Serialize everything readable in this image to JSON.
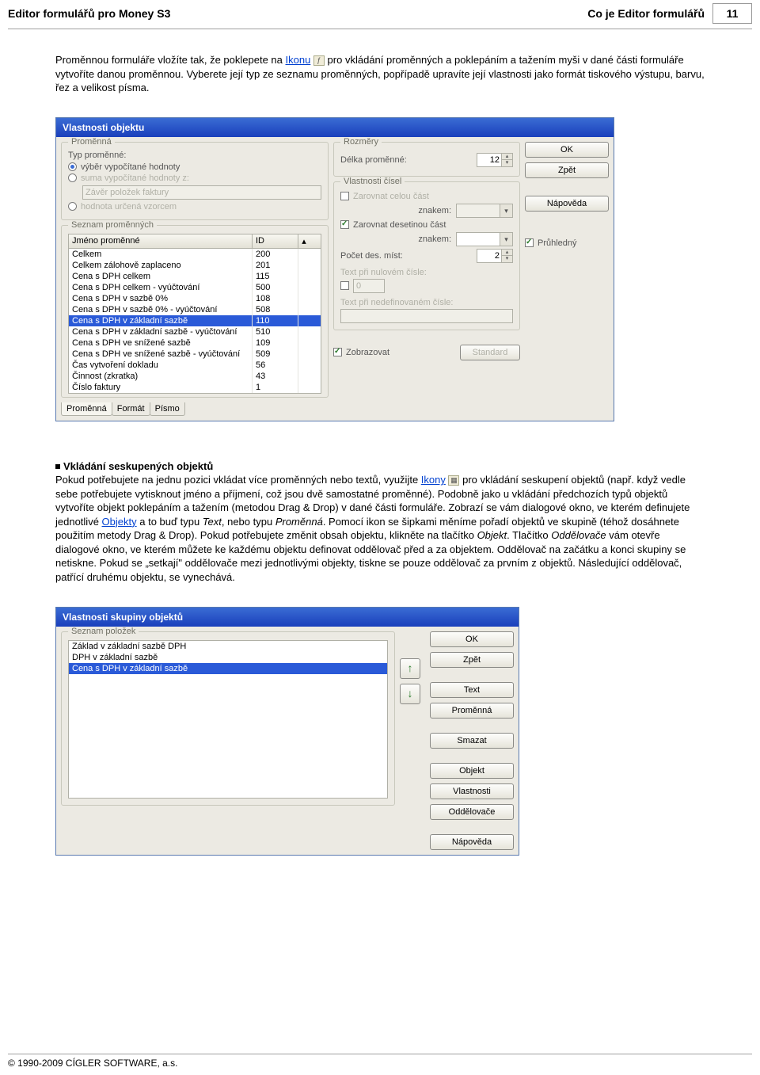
{
  "header": {
    "left": "Editor formulářů pro Money S3",
    "right": "Co je Editor formulářů",
    "pagenum": "11"
  },
  "para1_a": "Proměnnou formuláře vložíte tak, že poklepete na ",
  "para1_link": "Ikonu",
  "para1_b": " pro vkládání proměnných a poklepáním a tažením myši v dané části formuláře vytvoříte danou proměnnou. Vyberete její typ ze seznamu proměnných, popřípadě upravíte její vlastnosti jako formát tiskového výstupu, barvu, řez a velikost písma.",
  "dlg1": {
    "title": "Vlastnosti objektu",
    "grp_var": "Proměnná",
    "lbl_typ": "Typ proměnné:",
    "r1": "výběr vypočítané hodnoty",
    "r2": "suma vypočítané hodnoty z:",
    "r2_field": "Závěr položek faktury",
    "r3": "hodnota určená vzorcem",
    "grp_list": "Seznam proměnných",
    "col1": "Jméno proměnné",
    "col2": "ID",
    "rows": [
      {
        "n": "Celkem",
        "id": "200"
      },
      {
        "n": "Celkem zálohově zaplaceno",
        "id": "201"
      },
      {
        "n": "Cena s DPH celkem",
        "id": "115"
      },
      {
        "n": "Cena s DPH celkem - vyúčtování",
        "id": "500"
      },
      {
        "n": "Cena s DPH v sazbě 0%",
        "id": "108"
      },
      {
        "n": "Cena s DPH v sazbě 0% - vyúčtování",
        "id": "508"
      },
      {
        "n": "Cena s DPH v základní sazbě",
        "id": "110",
        "sel": true
      },
      {
        "n": "Cena s DPH v základní sazbě - vyúčtování",
        "id": "510"
      },
      {
        "n": "Cena s DPH ve snížené sazbě",
        "id": "109"
      },
      {
        "n": "Cena s DPH ve snížené sazbě - vyúčtování",
        "id": "509"
      },
      {
        "n": "Čas vytvoření dokladu",
        "id": "56"
      },
      {
        "n": "Činnost (zkratka)",
        "id": "43"
      },
      {
        "n": "Číslo faktury",
        "id": "1"
      }
    ],
    "tabs": [
      "Proměnná",
      "Formát",
      "Písmo"
    ],
    "grp_dim": "Rozměry",
    "lbl_delka": "Délka proměnné:",
    "val_delka": "12",
    "grp_cisl": "Vlastnosti čísel",
    "chk_zarovnat_cela": "Zarovnat celou část",
    "lbl_znakem1": "znakem:",
    "chk_zarovnat_des": "Zarovnat desetinou část",
    "lbl_znakem2": "znakem:",
    "lbl_pocet": "Počet des. míst:",
    "val_pocet": "2",
    "lbl_textnul": "Text při nulovém čísle:",
    "val_textnul": "0",
    "lbl_textnedef": "Text při nedefinovaném čísle:",
    "chk_zobrazovat": "Zobrazovat",
    "btn_standard": "Standard",
    "btn_ok": "OK",
    "btn_zpet": "Zpět",
    "btn_napoveda": "Nápověda",
    "chk_pruhledny": "Průhledný"
  },
  "section_title": "Vkládání seskupených objektů",
  "para2_a": "Pokud potřebujete na jednu pozici vkládat více proměnných nebo textů, využijte ",
  "para2_link1": "Ikony",
  "para2_b": "  pro vkládání seskupení objektů (např. když vedle sebe potřebujete vytisknout jméno a příjmení, což jsou dvě samostatné proměnné). Podobně jako u vkládání předchozích typů objektů vytvoříte objekt poklepáním a tažením (metodou Drag & Drop) v dané části formuláře. Zobrazí se vám dialogové okno, ve kterém definujete jednotlivé ",
  "para2_link2": "Objekty",
  "para2_c": " a to buď typu ",
  "para2_it1": "Text",
  "para2_d": ", nebo typu ",
  "para2_it2": "Proměnná",
  "para2_e": ". Pomocí ikon se šipkami měníme pořadí objektů ve skupině (téhož dosáhnete použitím metody Drag & Drop). Pokud potřebujete změnit obsah objektu, klikněte na tlačítko ",
  "para2_it3": "Objekt",
  "para2_f": ". Tlačítko ",
  "para2_it4": "Oddělovače",
  "para2_g": " vám otevře dialogové okno, ve kterém můžete ke každému objektu definovat oddělovač před a za objektem. Oddělovač na začátku a konci skupiny se netiskne. Pokud se „setkají\" oddělovače mezi jednotlivými objekty, tiskne se pouze oddělovač za prvním z objektů. Následující oddělovač, patřící druhému objektu, se vynechává.",
  "dlg2": {
    "title": "Vlastnosti skupiny objektů",
    "grp_list": "Seznam položek",
    "items": [
      {
        "t": "Základ v základní sazbě DPH"
      },
      {
        "t": "DPH v základní sazbě"
      },
      {
        "t": "Cena s DPH v základní sazbě",
        "sel": true
      }
    ],
    "btn_ok": "OK",
    "btn_zpet": "Zpět",
    "btn_text": "Text",
    "btn_prom": "Proměnná",
    "btn_smazat": "Smazat",
    "btn_objekt": "Objekt",
    "btn_vlast": "Vlastnosti",
    "btn_odd": "Oddělovače",
    "btn_napoveda": "Nápověda"
  },
  "footer": "© 1990-2009 CÍGLER SOFTWARE, a.s."
}
